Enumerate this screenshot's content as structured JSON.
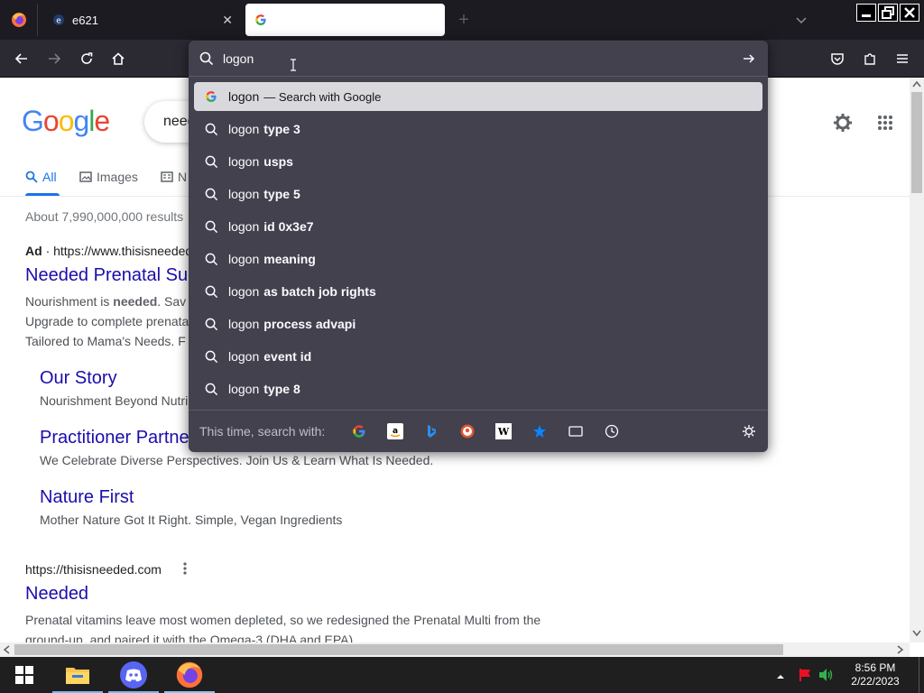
{
  "tabs": {
    "firefox_view_label": "",
    "tab1_title": "e621",
    "tab2_title": ""
  },
  "urlbar": {
    "value": "logon",
    "first_suggestion_query": "logon",
    "first_suggestion_action": "— Search with Google",
    "suggestions": [
      {
        "typed": "logon",
        "completion": "type 3"
      },
      {
        "typed": "logon",
        "completion": "usps"
      },
      {
        "typed": "logon",
        "completion": "type 5"
      },
      {
        "typed": "logon",
        "completion": "id 0x3e7"
      },
      {
        "typed": "logon",
        "completion": "meaning"
      },
      {
        "typed": "logon",
        "completion": "as batch job rights"
      },
      {
        "typed": "logon",
        "completion": "process advapi"
      },
      {
        "typed": "logon",
        "completion": "event id"
      },
      {
        "typed": "logon",
        "completion": "type 8"
      }
    ],
    "one_time_label": "This time, search with:"
  },
  "google": {
    "logo_text": "Google",
    "query": "neede",
    "tabs": {
      "all": "All",
      "images": "Images",
      "news": "N"
    },
    "result_stats": "About 7,990,000,000 results",
    "ad_label": "Ad",
    "ad_url": "· https://www.thisisneeded",
    "ad_title": "Needed Prenatal Su",
    "ad_desc_1_pre": "Nourishment is ",
    "ad_desc_1_bold": "needed",
    "ad_desc_1_post": ". Sav",
    "ad_desc_2": "Upgrade to complete prenata",
    "ad_desc_3": "Tailored to Mama's Needs. F",
    "sitelinks": [
      {
        "title": "Our Story",
        "desc": "Nourishment Beyond Nutri"
      },
      {
        "title": "Practitioner Partne",
        "desc": "We Celebrate Diverse Perspectives. Join Us & Learn What Is Needed."
      },
      {
        "title": "Nature First",
        "desc": "Mother Nature Got It Right. Simple, Vegan Ingredients"
      }
    ],
    "organic_url": "https://thisisneeded.com",
    "organic_title": "Needed",
    "organic_desc_1": "Prenatal vitamins leave most women depleted, so we redesigned the Prenatal Multi from the",
    "organic_desc_2": "ground-up, and paired it with the Omega-3 (DHA and EPA)."
  },
  "taskbar": {
    "time": "8:56 PM",
    "date": "2/22/2023"
  },
  "colors": {
    "tabstrip": "#1c1b22",
    "toolbar": "#2b2a33",
    "panel": "#42414d",
    "selected_row": "#d9d9dd",
    "google_link": "#1a0dab",
    "google_blue": "#1a73e8"
  }
}
